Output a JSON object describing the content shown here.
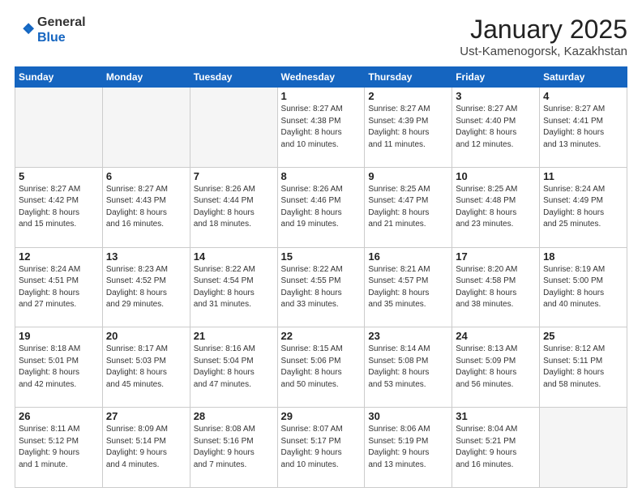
{
  "logo": {
    "general": "General",
    "blue": "Blue"
  },
  "title": "January 2025",
  "subtitle": "Ust-Kamenogorsk, Kazakhstan",
  "headers": [
    "Sunday",
    "Monday",
    "Tuesday",
    "Wednesday",
    "Thursday",
    "Friday",
    "Saturday"
  ],
  "weeks": [
    [
      {
        "day": "",
        "info": ""
      },
      {
        "day": "",
        "info": ""
      },
      {
        "day": "",
        "info": ""
      },
      {
        "day": "1",
        "info": "Sunrise: 8:27 AM\nSunset: 4:38 PM\nDaylight: 8 hours\nand 10 minutes."
      },
      {
        "day": "2",
        "info": "Sunrise: 8:27 AM\nSunset: 4:39 PM\nDaylight: 8 hours\nand 11 minutes."
      },
      {
        "day": "3",
        "info": "Sunrise: 8:27 AM\nSunset: 4:40 PM\nDaylight: 8 hours\nand 12 minutes."
      },
      {
        "day": "4",
        "info": "Sunrise: 8:27 AM\nSunset: 4:41 PM\nDaylight: 8 hours\nand 13 minutes."
      }
    ],
    [
      {
        "day": "5",
        "info": "Sunrise: 8:27 AM\nSunset: 4:42 PM\nDaylight: 8 hours\nand 15 minutes."
      },
      {
        "day": "6",
        "info": "Sunrise: 8:27 AM\nSunset: 4:43 PM\nDaylight: 8 hours\nand 16 minutes."
      },
      {
        "day": "7",
        "info": "Sunrise: 8:26 AM\nSunset: 4:44 PM\nDaylight: 8 hours\nand 18 minutes."
      },
      {
        "day": "8",
        "info": "Sunrise: 8:26 AM\nSunset: 4:46 PM\nDaylight: 8 hours\nand 19 minutes."
      },
      {
        "day": "9",
        "info": "Sunrise: 8:25 AM\nSunset: 4:47 PM\nDaylight: 8 hours\nand 21 minutes."
      },
      {
        "day": "10",
        "info": "Sunrise: 8:25 AM\nSunset: 4:48 PM\nDaylight: 8 hours\nand 23 minutes."
      },
      {
        "day": "11",
        "info": "Sunrise: 8:24 AM\nSunset: 4:49 PM\nDaylight: 8 hours\nand 25 minutes."
      }
    ],
    [
      {
        "day": "12",
        "info": "Sunrise: 8:24 AM\nSunset: 4:51 PM\nDaylight: 8 hours\nand 27 minutes."
      },
      {
        "day": "13",
        "info": "Sunrise: 8:23 AM\nSunset: 4:52 PM\nDaylight: 8 hours\nand 29 minutes."
      },
      {
        "day": "14",
        "info": "Sunrise: 8:22 AM\nSunset: 4:54 PM\nDaylight: 8 hours\nand 31 minutes."
      },
      {
        "day": "15",
        "info": "Sunrise: 8:22 AM\nSunset: 4:55 PM\nDaylight: 8 hours\nand 33 minutes."
      },
      {
        "day": "16",
        "info": "Sunrise: 8:21 AM\nSunset: 4:57 PM\nDaylight: 8 hours\nand 35 minutes."
      },
      {
        "day": "17",
        "info": "Sunrise: 8:20 AM\nSunset: 4:58 PM\nDaylight: 8 hours\nand 38 minutes."
      },
      {
        "day": "18",
        "info": "Sunrise: 8:19 AM\nSunset: 5:00 PM\nDaylight: 8 hours\nand 40 minutes."
      }
    ],
    [
      {
        "day": "19",
        "info": "Sunrise: 8:18 AM\nSunset: 5:01 PM\nDaylight: 8 hours\nand 42 minutes."
      },
      {
        "day": "20",
        "info": "Sunrise: 8:17 AM\nSunset: 5:03 PM\nDaylight: 8 hours\nand 45 minutes."
      },
      {
        "day": "21",
        "info": "Sunrise: 8:16 AM\nSunset: 5:04 PM\nDaylight: 8 hours\nand 47 minutes."
      },
      {
        "day": "22",
        "info": "Sunrise: 8:15 AM\nSunset: 5:06 PM\nDaylight: 8 hours\nand 50 minutes."
      },
      {
        "day": "23",
        "info": "Sunrise: 8:14 AM\nSunset: 5:08 PM\nDaylight: 8 hours\nand 53 minutes."
      },
      {
        "day": "24",
        "info": "Sunrise: 8:13 AM\nSunset: 5:09 PM\nDaylight: 8 hours\nand 56 minutes."
      },
      {
        "day": "25",
        "info": "Sunrise: 8:12 AM\nSunset: 5:11 PM\nDaylight: 8 hours\nand 58 minutes."
      }
    ],
    [
      {
        "day": "26",
        "info": "Sunrise: 8:11 AM\nSunset: 5:12 PM\nDaylight: 9 hours\nand 1 minute."
      },
      {
        "day": "27",
        "info": "Sunrise: 8:09 AM\nSunset: 5:14 PM\nDaylight: 9 hours\nand 4 minutes."
      },
      {
        "day": "28",
        "info": "Sunrise: 8:08 AM\nSunset: 5:16 PM\nDaylight: 9 hours\nand 7 minutes."
      },
      {
        "day": "29",
        "info": "Sunrise: 8:07 AM\nSunset: 5:17 PM\nDaylight: 9 hours\nand 10 minutes."
      },
      {
        "day": "30",
        "info": "Sunrise: 8:06 AM\nSunset: 5:19 PM\nDaylight: 9 hours\nand 13 minutes."
      },
      {
        "day": "31",
        "info": "Sunrise: 8:04 AM\nSunset: 5:21 PM\nDaylight: 9 hours\nand 16 minutes."
      },
      {
        "day": "",
        "info": ""
      }
    ]
  ]
}
